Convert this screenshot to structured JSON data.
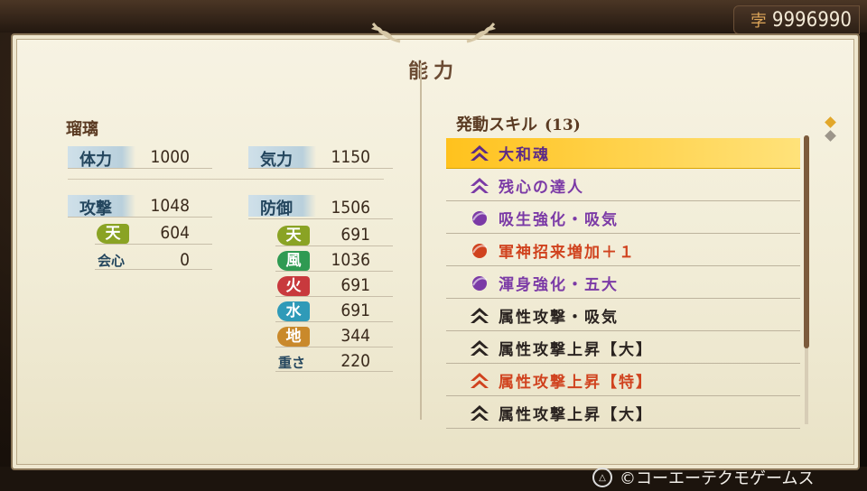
{
  "currency": {
    "icon": "coin-icon",
    "value": "9996990"
  },
  "panel": {
    "title": "能力"
  },
  "character": {
    "name": "瑠璃",
    "hp_label": "体力",
    "hp_value": "1000",
    "ki_label": "気力",
    "ki_value": "1150",
    "attack_label": "攻撃",
    "attack_value": "1048",
    "defense_label": "防御",
    "defense_value": "1506",
    "atk_elem": {
      "label": "天",
      "value": "604",
      "color": "#8aa324"
    },
    "crit_label": "会心",
    "crit_value": "0",
    "def_elems": [
      {
        "label": "天",
        "value": "691",
        "color": "#8aa324"
      },
      {
        "label": "風",
        "value": "1036",
        "color": "#2f9a52"
      },
      {
        "label": "火",
        "value": "691",
        "color": "#c8393d"
      },
      {
        "label": "水",
        "value": "691",
        "color": "#2f9ab8"
      },
      {
        "label": "地",
        "value": "344",
        "color": "#c9892b"
      }
    ],
    "weight_label": "重さ",
    "weight_value": "220"
  },
  "skills": {
    "title": "発動スキル",
    "count": "(13)",
    "items": [
      {
        "name": "大和魂",
        "icon": "purple-chevron-icon",
        "color": "#5b2a88",
        "selected": true
      },
      {
        "name": "残心の達人",
        "icon": "purple-chevron-icon",
        "color": "#7b3aa6",
        "selected": false
      },
      {
        "name": "吸生強化・吸気",
        "icon": "purple-orb-icon",
        "color": "#7b3aa6",
        "selected": false
      },
      {
        "name": "軍神招来増加＋１",
        "icon": "red-orb-icon",
        "color": "#d0421e",
        "selected": false
      },
      {
        "name": "渾身強化・五大",
        "icon": "purple-orb-icon",
        "color": "#7b3aa6",
        "selected": false
      },
      {
        "name": "属性攻撃・吸気",
        "icon": "black-chevron-icon",
        "color": "#2a2320",
        "selected": false
      },
      {
        "name": "属性攻撃上昇【大】",
        "icon": "black-chevron-icon",
        "color": "#2a2320",
        "selected": false
      },
      {
        "name": "属性攻撃上昇【特】",
        "icon": "red-chevron-icon",
        "color": "#d0421e",
        "selected": false
      },
      {
        "name": "属性攻撃上昇【大】",
        "icon": "black-chevron-icon",
        "color": "#2a2320",
        "selected": false
      }
    ]
  },
  "footer": {
    "button_icon": "triangle-button-icon",
    "text": "©コーエーテクモゲームス"
  }
}
